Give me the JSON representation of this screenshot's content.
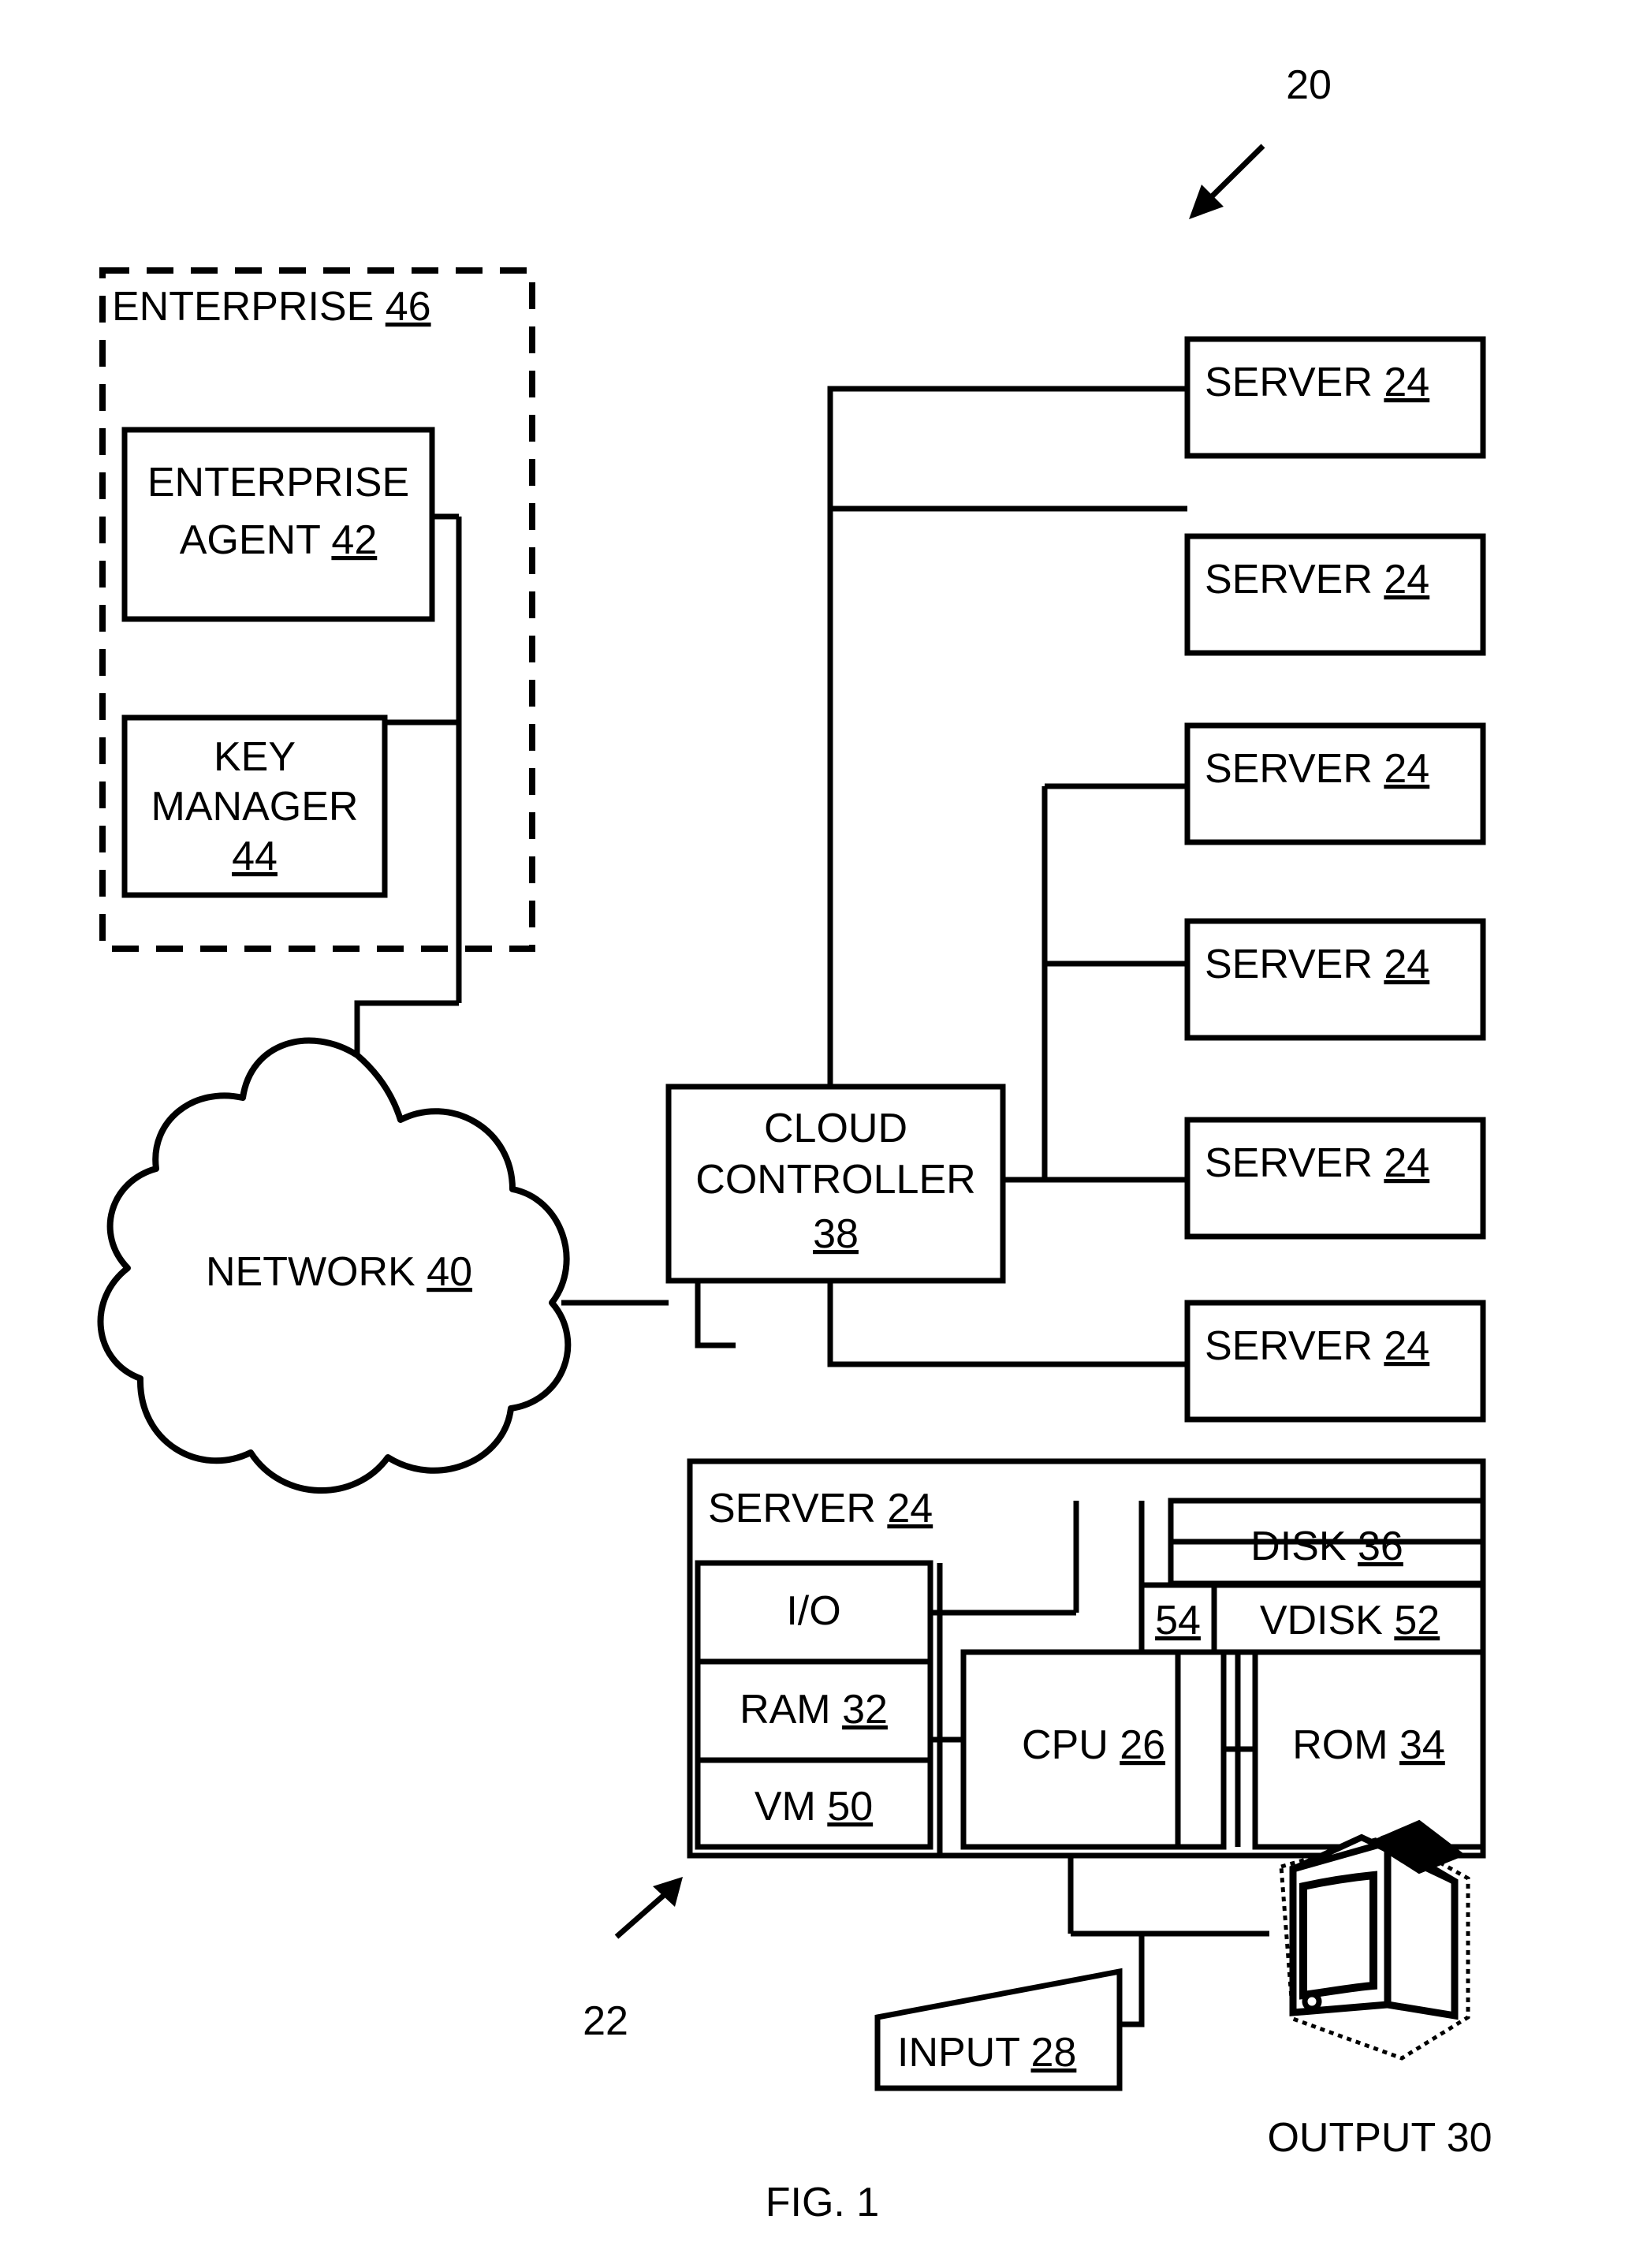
{
  "figure": {
    "caption": "FIG. 1",
    "system_ref": "20",
    "server_detail_ref": "22"
  },
  "enterprise": {
    "title_text": "ENTERPRISE",
    "title_ref": "46",
    "blocks": [
      {
        "line1": "ENTERPRISE",
        "line2": "AGENT",
        "ref": "42",
        "name": "enterprise-agent"
      },
      {
        "line1": "KEY",
        "line2": "MANAGER",
        "ref": "44",
        "name": "key-manager"
      }
    ]
  },
  "network": {
    "label": "NETWORK",
    "ref": "40"
  },
  "cloud_controller": {
    "line1": "CLOUD",
    "line2": "CONTROLLER",
    "ref": "38"
  },
  "servers": {
    "label": "SERVER",
    "ref": "24",
    "count": 6,
    "items": [
      {
        "label": "SERVER",
        "ref": "24"
      },
      {
        "label": "SERVER",
        "ref": "24"
      },
      {
        "label": "SERVER",
        "ref": "24"
      },
      {
        "label": "SERVER",
        "ref": "24"
      },
      {
        "label": "SERVER",
        "ref": "24"
      },
      {
        "label": "SERVER",
        "ref": "24"
      }
    ]
  },
  "server_detail": {
    "title": "SERVER",
    "title_ref": "24",
    "components": [
      {
        "name": "io",
        "label": "I/O",
        "ref": ""
      },
      {
        "name": "ram",
        "label": "RAM",
        "ref": "32"
      },
      {
        "name": "vm",
        "label": "VM",
        "ref": "50"
      },
      {
        "name": "cpu",
        "label": "CPU",
        "ref": "26"
      },
      {
        "name": "rom",
        "label": "ROM",
        "ref": "34"
      },
      {
        "name": "disk",
        "label": "DISK",
        "ref": "36"
      },
      {
        "name": "vdisk",
        "label": "VDISK",
        "ref": "52"
      },
      {
        "name": "link54",
        "label": "",
        "ref": "54"
      }
    ]
  },
  "peripherals": {
    "input": {
      "label": "INPUT",
      "ref": "28"
    },
    "output": {
      "label": "OUTPUT",
      "ref": "30"
    }
  }
}
